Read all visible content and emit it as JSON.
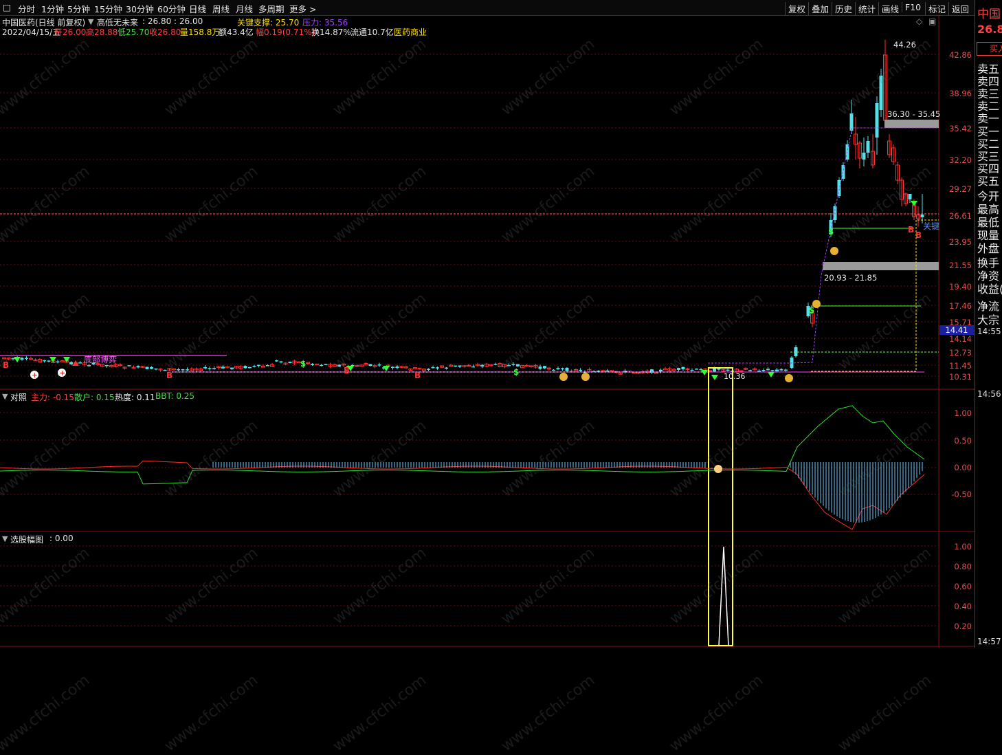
{
  "toolbar": {
    "window_icon": "□",
    "periods": [
      "分时",
      "1分钟",
      "5分钟",
      "15分钟",
      "30分钟",
      "60分钟",
      "日线",
      "周线",
      "月线",
      "多周期",
      "更多 >"
    ],
    "active_period": "日线",
    "right_buttons": [
      "复权",
      "叠加",
      "历史",
      "统计",
      "画线",
      "F10",
      "标记",
      "返回"
    ]
  },
  "header": {
    "title": "中国医药(日线 前复权)",
    "indicator_name": "高低无未来",
    "indicator_values": ": 26.80 : 26.00",
    "support_label": "关键支撑: 25.70",
    "pressure_label": "压力: 35.56",
    "icons": [
      "◇",
      "▣"
    ]
  },
  "quote": {
    "date": "2022/04/15/五",
    "open": "开26.00",
    "high": "高28.88",
    "low": "低25.70",
    "close": "收26.80",
    "volume": "量158.8万",
    "amount": "额43.4亿",
    "change": "幅0.19(0.71%)",
    "turnover": "换14.87%",
    "float": "流通10.7亿",
    "sector": "医药商业"
  },
  "main_axis": [
    "42.86",
    "38.96",
    "35.42",
    "32.20",
    "29.27",
    "26.61",
    "23.95",
    "21.55",
    "19.40",
    "17.46",
    "15.71",
    "14.14",
    "12.73",
    "11.45",
    "10.31"
  ],
  "current_price_tag": "14.41",
  "annotations": {
    "peak": "44.26",
    "zone_upper": "36.30 - 35.45",
    "zone_lower": "20.93 - 21.85",
    "low_mark": "10.36",
    "key_label": "关键",
    "left_text": "底部博弈"
  },
  "sub1": {
    "name": "对照",
    "main_force": "主力: -0.15",
    "retail": "散户: 0.15",
    "heat": "热度: 0.11",
    "bbt": "BBT: 0.25",
    "axis": [
      "1.00",
      "0.50",
      "0.00",
      "-0.50"
    ]
  },
  "sub2": {
    "name": "选股幅图",
    "value": ": 0.00",
    "axis": [
      "1.00",
      "0.80",
      "0.60",
      "0.40",
      "0.20"
    ]
  },
  "right_panel": {
    "stock_name": "中国",
    "price": "26.8",
    "buy_button": "买入",
    "labels": [
      "卖五",
      "卖四",
      "卖三",
      "卖二",
      "卖一",
      "买一",
      "买二",
      "买三",
      "买四",
      "买五",
      "今开",
      "最高",
      "最低",
      "现量",
      "外盘",
      "换手",
      "净资",
      "收益(",
      "净流",
      "大宗"
    ],
    "times": [
      "14:55",
      "14:56",
      "14:57"
    ]
  },
  "colors": {
    "up": "#ff3333",
    "down": "#55e0e8",
    "grid": "#6a0d0d",
    "axis_text": "#e05050",
    "support": "#ffe000",
    "pressure": "#a040ff",
    "highlight_box": "#ffff33",
    "zone": "#9a9a9a"
  },
  "watermark": "www.cfchi.com"
}
